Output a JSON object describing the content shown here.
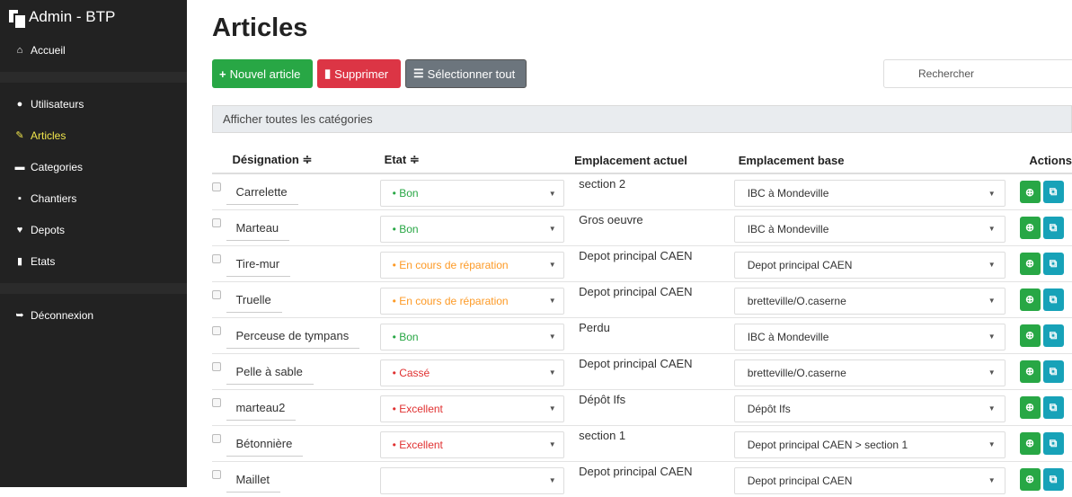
{
  "app": {
    "brand": "Admin - BTP"
  },
  "sidebar": {
    "items": [
      {
        "label": "Accueil",
        "icon": "home-icon",
        "glyph": "⌂"
      },
      {
        "label": "Utilisateurs",
        "icon": "user-icon",
        "glyph": "●"
      },
      {
        "label": "Articles",
        "icon": "wrench-icon",
        "glyph": "✎"
      },
      {
        "label": "Categories",
        "icon": "folder-icon",
        "glyph": "▬"
      },
      {
        "label": "Chantiers",
        "icon": "truck-icon",
        "glyph": "▪"
      },
      {
        "label": "Depots",
        "icon": "map-marker-icon",
        "glyph": "♥"
      },
      {
        "label": "Etats",
        "icon": "file-icon",
        "glyph": "▮"
      },
      {
        "label": "Déconnexion",
        "icon": "logout-icon",
        "glyph": "➥"
      }
    ],
    "active": "Articles"
  },
  "page": {
    "title": "Articles"
  },
  "toolbar": {
    "add_label": "Nouvel article",
    "delete_label": "Supprimer",
    "select_all_label": "Sélectionner tout"
  },
  "search": {
    "placeholder": "Rechercher"
  },
  "category_filter": "Afficher toutes les catégories",
  "table": {
    "headers": {
      "designation": "Désignation ≑",
      "etat": "Etat ≑",
      "emplacement_actuel": "Emplacement actuel",
      "emplacement_base": "Emplacement base",
      "actions": "Actions"
    },
    "rows": [
      {
        "designation": "Carrelette",
        "etat": "• Bon",
        "etat_color": "#28a745",
        "emplacement_actuel": "section 2",
        "emplacement_base": "IBC à Mondeville"
      },
      {
        "designation": "Marteau",
        "etat": "• Bon",
        "etat_color": "#28a745",
        "emplacement_actuel": "Gros oeuvre",
        "emplacement_base": "IBC à Mondeville"
      },
      {
        "designation": "Tire-mur",
        "etat": "• En cours de réparation",
        "etat_color": "#fd9a26",
        "emplacement_actuel": "Depot principal CAEN",
        "emplacement_base": "Depot principal CAEN"
      },
      {
        "designation": "Truelle",
        "etat": "• En cours de réparation",
        "etat_color": "#fd9a26",
        "emplacement_actuel": "Depot principal CAEN",
        "emplacement_base": "bretteville/O.caserne"
      },
      {
        "designation": "Perceuse de tympans",
        "etat": "• Bon",
        "etat_color": "#28a745",
        "emplacement_actuel": "Perdu",
        "emplacement_base": "IBC à Mondeville"
      },
      {
        "designation": "Pelle à sable",
        "etat": "• Cassé",
        "etat_color": "#e03131",
        "emplacement_actuel": "Depot principal CAEN",
        "emplacement_base": "bretteville/O.caserne"
      },
      {
        "designation": "marteau2",
        "etat": "• Excellent",
        "etat_color": "#e03131",
        "emplacement_actuel": "Dépôt Ifs",
        "emplacement_base": "Dépôt Ifs"
      },
      {
        "designation": "Bétonnière",
        "etat": "• Excellent",
        "etat_color": "#e03131",
        "emplacement_actuel": "section 1",
        "emplacement_base": "Depot principal CAEN > section 1"
      },
      {
        "designation": "Maillet",
        "etat": "",
        "etat_color": "#333333",
        "emplacement_actuel": "Depot principal CAEN",
        "emplacement_base": "Depot principal CAEN"
      }
    ]
  },
  "colors": {
    "sidebar_bg": "#222222",
    "active_nav": "#f0e54c",
    "success": "#28a745",
    "danger": "#dc3545",
    "secondary": "#6c757d",
    "info": "#17a2b8"
  }
}
